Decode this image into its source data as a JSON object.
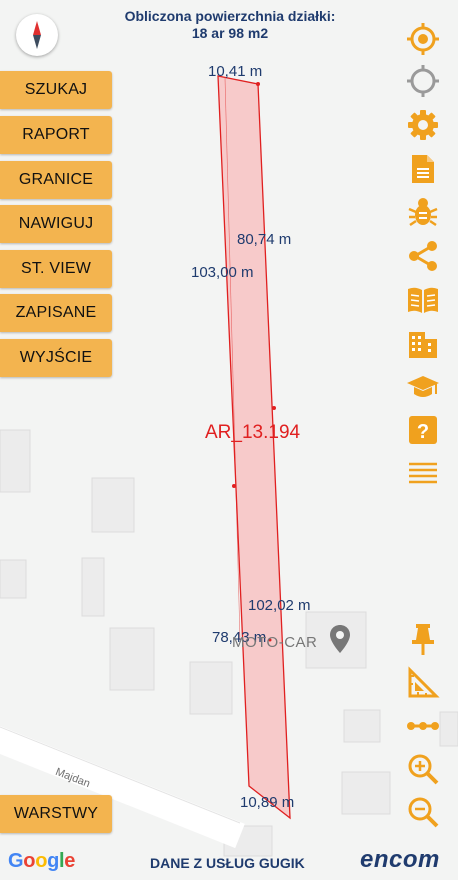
{
  "header": {
    "line1": "Obliczona powierzchnia działki:",
    "line2": "18 ar 98 m2"
  },
  "compass": {
    "icon": "compass-icon"
  },
  "menu": {
    "search": "SZUKAJ",
    "report": "RAPORT",
    "bounds": "GRANICE",
    "navigate": "NAWIGUJ",
    "street_view": "ST. VIEW",
    "saved": "ZAPISANE",
    "exit": "WYJŚCIE",
    "layers": "WARSTWY"
  },
  "right_toolbar": {
    "accent_color": "#f0a11e",
    "inactive_color": "#9a9a9a",
    "icons": [
      "gps-active-icon",
      "gps-inactive-icon",
      "gear-icon",
      "document-icon",
      "bug-icon",
      "share-icon",
      "book-icon",
      "building-icon",
      "graduation-cap-icon",
      "help-icon",
      "menu-lines-icon",
      "pin-icon",
      "ruler-icon",
      "measure-line-icon",
      "zoom-in-icon",
      "zoom-out-icon"
    ]
  },
  "parcel": {
    "id": "AR_13.194",
    "fill_color": "#f7c5c5",
    "border_color": "#e02020",
    "edges": {
      "top": "10,41 m",
      "inner_upper": "80,74 m",
      "left_upper": "103,00 m",
      "right_lower": "102,02 m",
      "left_lower": "78,43 m",
      "bottom": "10,89 m"
    }
  },
  "map": {
    "poi": "MOTO-CAR",
    "street": "Majdan"
  },
  "footer": {
    "google": [
      "G",
      "o",
      "o",
      "g",
      "l",
      "e"
    ],
    "google_colors": [
      "#4285F4",
      "#EA4335",
      "#FBBC05",
      "#4285F4",
      "#34A853",
      "#EA4335"
    ],
    "credit": "DANE Z USŁUG GUGIK",
    "brand": "encom"
  }
}
